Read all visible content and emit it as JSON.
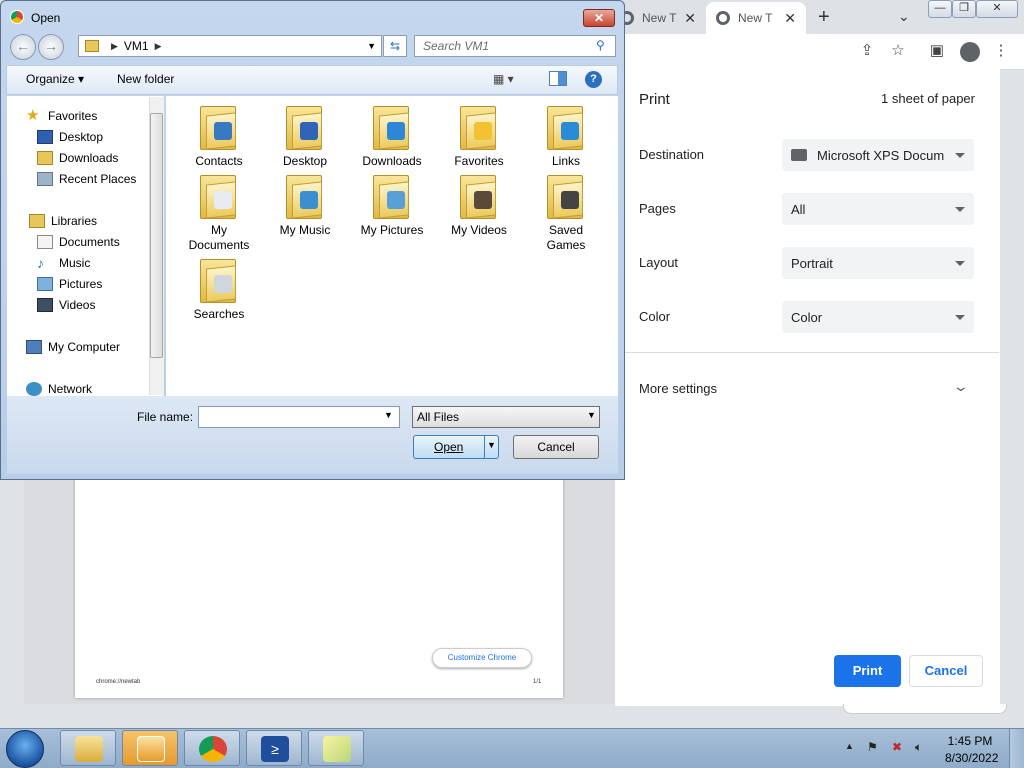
{
  "chrome": {
    "tabs": [
      {
        "title": "New T"
      },
      {
        "title": "New T"
      }
    ],
    "tab_close": "✕",
    "new_tab": "+",
    "tab_menu": "⌄",
    "window_controls": {
      "minimize": "—",
      "maximize": "❐",
      "close": "✕"
    }
  },
  "preview": {
    "customize_label": "Customize Chrome",
    "page_url": "chrome://newtab",
    "page_number": "1/1"
  },
  "print": {
    "title": "Print",
    "sheets": "1 sheet of paper",
    "destination_label": "Destination",
    "destination_value": "Microsoft XPS Docum",
    "pages_label": "Pages",
    "pages_value": "All",
    "layout_label": "Layout",
    "layout_value": "Portrait",
    "color_label": "Color",
    "color_value": "Color",
    "more_settings": "More settings",
    "print_button": "Print",
    "cancel_button": "Cancel"
  },
  "dialog": {
    "title": "Open",
    "close": "✕",
    "address": {
      "path": "VM1"
    },
    "search_placeholder": "Search VM1",
    "toolbar": {
      "organize": "Organize ▾",
      "new_folder": "New folder"
    },
    "nav": {
      "favorites": "Favorites",
      "desktop": "Desktop",
      "downloads": "Downloads",
      "recent_places": "Recent Places",
      "libraries": "Libraries",
      "documents": "Documents",
      "music": "Music",
      "pictures": "Pictures",
      "videos": "Videos",
      "my_computer": "My Computer",
      "network": "Network"
    },
    "files": [
      {
        "name": "Contacts",
        "color": "#3a78c2"
      },
      {
        "name": "Desktop",
        "color": "#2f64b8"
      },
      {
        "name": "Downloads",
        "color": "#2d86d6"
      },
      {
        "name": "Favorites",
        "color": "#f2c230"
      },
      {
        "name": "Links",
        "color": "#2a8bd8"
      },
      {
        "name": "My Documents",
        "color": "#e8ecf2"
      },
      {
        "name": "My Music",
        "color": "#3a8fd0"
      },
      {
        "name": "My Pictures",
        "color": "#5aa0d8"
      },
      {
        "name": "My Videos",
        "color": "#5b4a3a"
      },
      {
        "name": "Saved Games",
        "color": "#444444"
      },
      {
        "name": "Searches",
        "color": "#cfd6de"
      }
    ],
    "file_name_label": "File name:",
    "file_name_value": "",
    "filter_value": "All Files",
    "open_button": "Open",
    "cancel_button": "Cancel"
  },
  "taskbar": {
    "time": "1:45 PM",
    "date": "8/30/2022",
    "tray_arrow": "▲"
  }
}
